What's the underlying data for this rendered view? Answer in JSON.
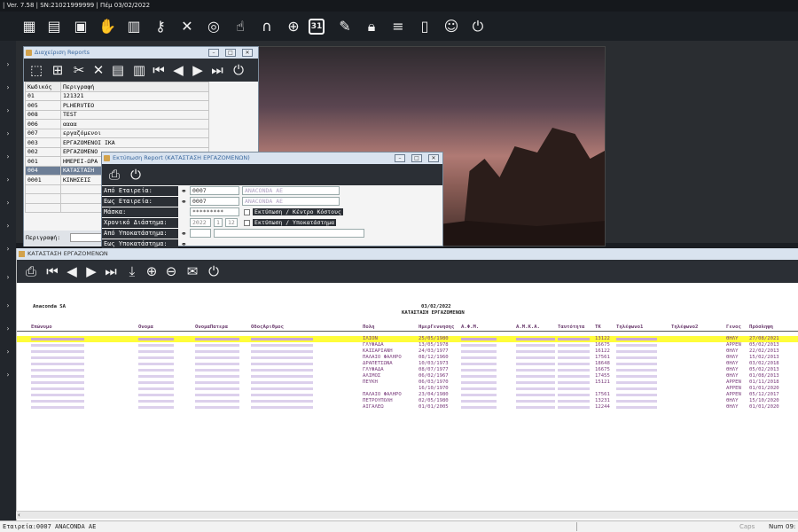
{
  "app": {
    "title_bar": "| Ver. 7.58 | SN:21021999999 | Πέμ 03/02/2022"
  },
  "main_toolbar": {
    "icons": [
      "company-icon",
      "documents-icon",
      "calendar-icon",
      "hand-coin-icon",
      "book-icon",
      "key-icon",
      "tools-icon",
      "lifebuoy-icon",
      "pointer-icon",
      "headset-icon",
      "globe-icon",
      "calendar-31-icon",
      "satellite-icon",
      "lock-icon",
      "database-icon",
      "notebook-icon",
      "user-settings-icon",
      "power-icon"
    ],
    "calendar_day": "31"
  },
  "reports_window": {
    "title": "Διαχείριση Reports",
    "columns": [
      "Κωδικός",
      "Περιγραφή"
    ],
    "rows": [
      {
        "code": "01",
        "desc": "121321"
      },
      {
        "code": "005",
        "desc": "PLHERVTEO"
      },
      {
        "code": "008",
        "desc": "TEST"
      },
      {
        "code": "006",
        "desc": "αααα"
      },
      {
        "code": "007",
        "desc": "εργαζόμενοι"
      },
      {
        "code": "003",
        "desc": "ΕΡΓΑΖΟΜΕΝΟΙ ΙΚΑ"
      },
      {
        "code": "002",
        "desc": "ΕΡΓΑΖΟΜΕΝΟ"
      },
      {
        "code": "001",
        "desc": "ΗΜΕΡΕΙ-ΩΡΑ"
      },
      {
        "code": "004",
        "desc": "ΚΑΤΑΣΤΑΣΗ"
      },
      {
        "code": "0001",
        "desc": "ΚΙΝΗΣΕΙΣ"
      }
    ],
    "selected_index": 8,
    "description_label": "Περιγραφή:"
  },
  "print_window": {
    "title": "Εκτύπωση Report (ΚΑΤΑΣΤΑΣΗ ΕΡΓΑΖΟΜΕΝΩΝ)",
    "from_company_label": "Από Εταιρεία:",
    "from_company_value": "0007",
    "from_company_name": "ANACONDA AE",
    "to_company_label": "Εως Εταιρεία:",
    "to_company_value": "0007",
    "to_company_name": "ANACONDA AE",
    "mask_label": "Μάσκα:",
    "mask_value": "*********",
    "period_label": "Χρονικό Διάστημα:",
    "year": "2022",
    "month_from": "1",
    "month_to": "12",
    "from_branch_label": "Από Υποκατάστημα:",
    "to_branch_label": "Εως Υποκατάστημα:",
    "check_cost_center": "Εκτύπωση / Κέντρο Κόστους",
    "check_branch": "Εκτύπωση / Υποκατάστημα"
  },
  "report_window": {
    "title": "ΚΑΤΑΣΤΑΣΗ ΕΡΓΑΖΟΜΕΝΩΝ",
    "company": "Anaconda SA",
    "date": "03/02/2022",
    "report_title": "ΚΑΤΑΣΤΑΣΗ ΕΡΓΑΖΟΜΕΝΩΝ",
    "columns": [
      "Επώνυμο",
      "Ονομα",
      "ΟνομαΠατερα",
      "ΟδοςΑριθμος",
      "Πολη",
      "ΗμερΓεννησης",
      "Α.Φ.Μ.",
      "Α.Μ.Κ.Α.",
      "Ταυτότητα",
      "ΤΚ",
      "Τηλέφωνο1",
      "Τηλέφωνο2",
      "Γενος",
      "Πρόσληψη"
    ],
    "rows": [
      {
        "city": "ΙΛΙΟΝ",
        "dob": "25/05/1980",
        "tk": "13122",
        "gender": "ΘΗΛΥ",
        "hire": "27/08/2021",
        "hl": true
      },
      {
        "city": "ΓΛΥΦΑΔΑ",
        "dob": "13/05/1978",
        "tk": "16675",
        "gender": "ΑΡΡΕΝ",
        "hire": "05/02/2013"
      },
      {
        "city": "ΚΑΙΣΑΡΙΑΝΗ",
        "dob": "24/03/1977",
        "tk": "16122",
        "gender": "ΘΗΛΥ",
        "hire": "22/02/2013"
      },
      {
        "city": "ΠΑΛΑΙΟ ΦΑΛΗΡΟ",
        "dob": "08/12/1960",
        "tk": "17561",
        "gender": "ΘΗΛΥ",
        "hire": "15/02/2013"
      },
      {
        "city": "ΔΡΑΠΕΤΣΩΝΑ",
        "dob": "10/03/1973",
        "tk": "18648",
        "gender": "ΘΗΛΥ",
        "hire": "03/02/2018"
      },
      {
        "city": "ΓΛΥΦΑΔΑ",
        "dob": "08/07/1977",
        "tk": "16675",
        "gender": "ΘΗΛΥ",
        "hire": "05/02/2013"
      },
      {
        "city": "ΑΛΙΜΟΣ",
        "dob": "06/02/1967",
        "tk": "17455",
        "gender": "ΘΗΛΥ",
        "hire": "01/08/2013"
      },
      {
        "city": "ΠΕΥΚΗ",
        "dob": "06/03/1970",
        "tk": "15121",
        "gender": "ΑΡΡΕΝ",
        "hire": "01/11/2018"
      },
      {
        "city": "",
        "dob": "16/10/1970",
        "tk": "",
        "gender": "ΑΡΡΕΝ",
        "hire": "01/01/2020"
      },
      {
        "city": "ΠΑΛΑΙΟ ΦΑΛΗΡΟ",
        "dob": "23/04/1980",
        "tk": "17561",
        "gender": "ΑΡΡΕΝ",
        "hire": "05/12/2017"
      },
      {
        "city": "ΠΕΤΡΟΥΠΟΛΗ",
        "dob": "02/05/1980",
        "tk": "13231",
        "gender": "ΘΗΛΥ",
        "hire": "15/10/2020"
      },
      {
        "city": "ΑΙΓΑΛΕΩ",
        "dob": "01/01/2005",
        "tk": "12244",
        "gender": "ΘΗΛΥ",
        "hire": "01/01/2020"
      }
    ]
  },
  "status": {
    "company": "Εταιρεία:0007 ANACONDA AE",
    "caps": "Caps",
    "num": "Num",
    "time": "09:"
  }
}
